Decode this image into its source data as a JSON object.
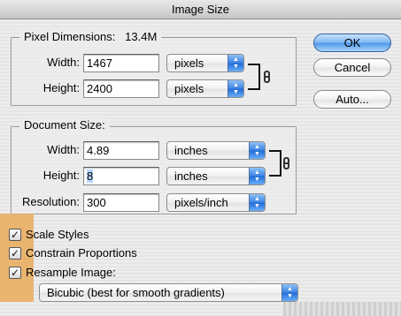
{
  "window": {
    "title": "Image Size"
  },
  "pixel_dimensions": {
    "title": "Pixel Dimensions:",
    "size": "13.4M",
    "width_label": "Width:",
    "width_value": "1467",
    "width_unit": "pixels",
    "height_label": "Height:",
    "height_value": "2400",
    "height_unit": "pixels"
  },
  "document_size": {
    "title": "Document Size:",
    "width_label": "Width:",
    "width_value": "4.89",
    "width_unit": "inches",
    "height_label": "Height:",
    "height_value": "8",
    "height_unit": "inches",
    "resolution_label": "Resolution:",
    "resolution_value": "300",
    "resolution_unit": "pixels/inch"
  },
  "buttons": {
    "ok": "OK",
    "cancel": "Cancel",
    "auto": "Auto..."
  },
  "options": {
    "scale_styles": {
      "label": "Scale Styles",
      "checked": true
    },
    "constrain_proportions": {
      "label": "Constrain Proportions",
      "checked": true
    },
    "resample_image": {
      "label": "Resample Image:",
      "checked": true
    },
    "resample_method": "Bicubic (best for smooth gradients)"
  },
  "icons": {
    "popup_arrows": "updown-arrows-icon",
    "chain_link": "chain-link-icon",
    "checkmark": "checkmark-icon"
  },
  "colors": {
    "default_button": "#4c97ea",
    "popup_arrows": "#3b82e3",
    "highlight_overlay": "#e9aa5a",
    "selection": "#b5d5ff"
  }
}
